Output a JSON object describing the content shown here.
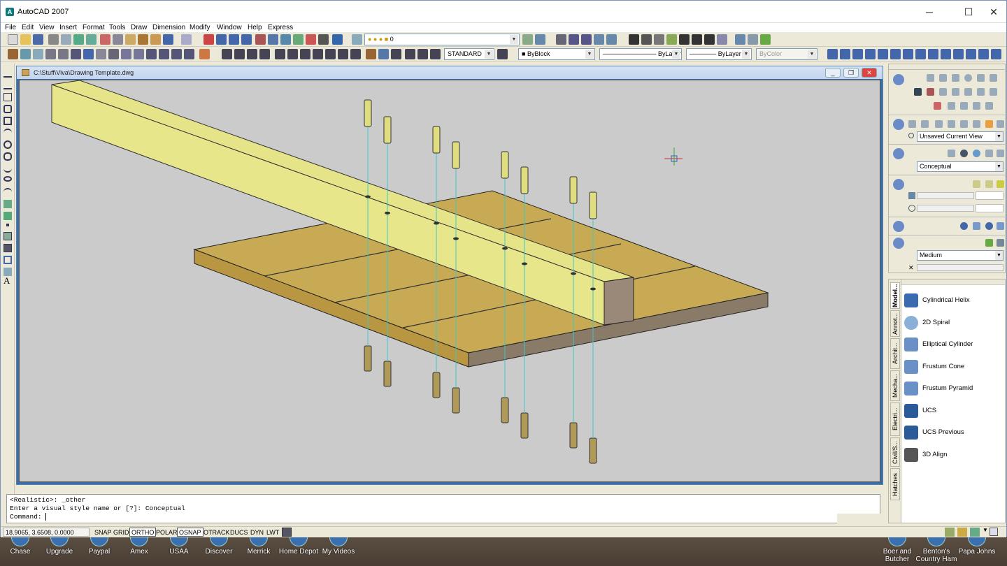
{
  "app": {
    "title": "AutoCAD 2007"
  },
  "menus": [
    "File",
    "Edit",
    "View",
    "Insert",
    "Format",
    "Tools",
    "Draw",
    "Dimension",
    "Modify",
    "Window",
    "Help",
    "Express"
  ],
  "toolbar": {
    "layer_value": "0",
    "text_style": "STANDARD",
    "color": "ByBlock",
    "linetype": "ByLayer",
    "lineweight": "ByLayer",
    "plotstyle": "ByColor"
  },
  "drawing": {
    "title": "C:\\Stuff\\Viva\\Drawing Template.dwg"
  },
  "command": {
    "line1": "<Realistic>: _other",
    "line2": "Enter a visual style name or [?]: Conceptual",
    "prompt": "Command:"
  },
  "status": {
    "coords": "18.9065, 3.6508, 0.0000",
    "buttons": [
      "SNAP",
      "GRID",
      "ORTHO",
      "POLAR",
      "OSNAP",
      "OTRACK",
      "DUCS",
      "DYN",
      "LWT"
    ],
    "on": [
      "ORTHO",
      "OSNAP"
    ]
  },
  "dashboard": {
    "view": "Unsaved Current View",
    "visual_style": "Conceptual",
    "shadow": "Medium"
  },
  "tool_palette": {
    "tabs": [
      "Model...",
      "Annot...",
      "Archit...",
      "Mecha...",
      "Electri...",
      "Civil/S...",
      "Hatches"
    ],
    "tools": [
      "Cylindrical Helix",
      "2D Spiral",
      "Elliptical Cylinder",
      "Frustum Cone",
      "Frustum Pyramid",
      "UCS",
      "UCS Previous",
      "3D Align"
    ]
  },
  "desktop_icons": [
    {
      "label": "Chase"
    },
    {
      "label": "Upgrade"
    },
    {
      "label": "Paypal"
    },
    {
      "label": "Amex"
    },
    {
      "label": "USAA"
    },
    {
      "label": "Discover"
    },
    {
      "label": "Merrick"
    },
    {
      "label": "Home Depot"
    },
    {
      "label": "My Videos"
    },
    {
      "label": "Boer and Butcher"
    },
    {
      "label": "Benton's Country Ham"
    },
    {
      "label": "Papa Johns"
    }
  ]
}
